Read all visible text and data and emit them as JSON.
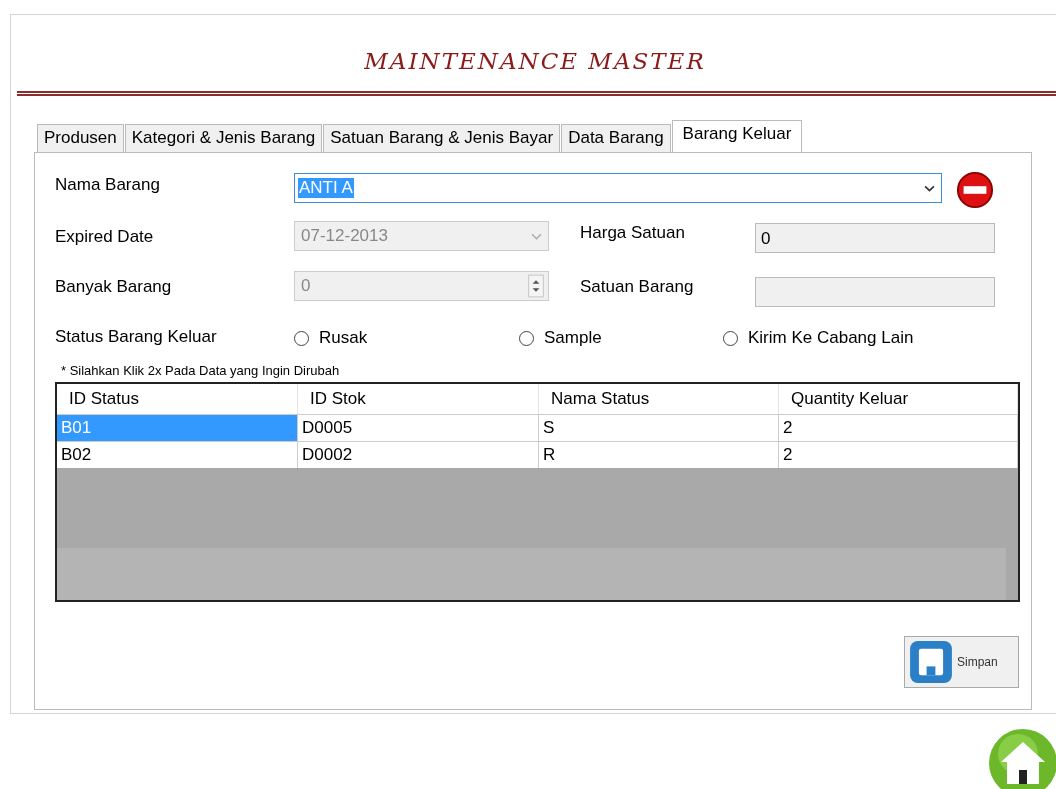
{
  "header": {
    "title": "MAINTENANCE MASTER"
  },
  "tabs": [
    {
      "label": "Produsen",
      "selected": false
    },
    {
      "label": "Kategori & Jenis Barang",
      "selected": false
    },
    {
      "label": "Satuan Barang & Jenis Bayar",
      "selected": false
    },
    {
      "label": "Data Barang",
      "selected": false
    },
    {
      "label": "Barang Keluar",
      "selected": true
    }
  ],
  "form": {
    "nama_barang": {
      "label": "Nama Barang",
      "value": "ANTI A"
    },
    "expired_date": {
      "label": "Expired Date",
      "value": "07-12-2013",
      "disabled": true
    },
    "harga_satuan": {
      "label": "Harga Satuan",
      "value": "0"
    },
    "banyak_barang": {
      "label": "Banyak Barang",
      "value": "0",
      "disabled": true
    },
    "satuan_barang": {
      "label": "Satuan Barang"
    },
    "status": {
      "label": "Status Barang Keluar",
      "options": [
        {
          "label": "Rusak",
          "selected": false
        },
        {
          "label": "Sample",
          "selected": false
        },
        {
          "label": "Kirim Ke Cabang Lain",
          "selected": false
        }
      ]
    }
  },
  "note": "* Silahkan Klik 2x Pada Data yang Ingin Dirubah",
  "table": {
    "columns": [
      "ID Status",
      "ID Stok",
      "Nama Status",
      "Quantity Keluar"
    ],
    "rows": [
      {
        "cells": [
          "B01",
          "D0005",
          "S",
          "2"
        ],
        "selected": true
      },
      {
        "cells": [
          "B02",
          "D0002",
          "R",
          "2"
        ],
        "selected": false
      }
    ]
  },
  "buttons": {
    "save": "Simpan"
  }
}
